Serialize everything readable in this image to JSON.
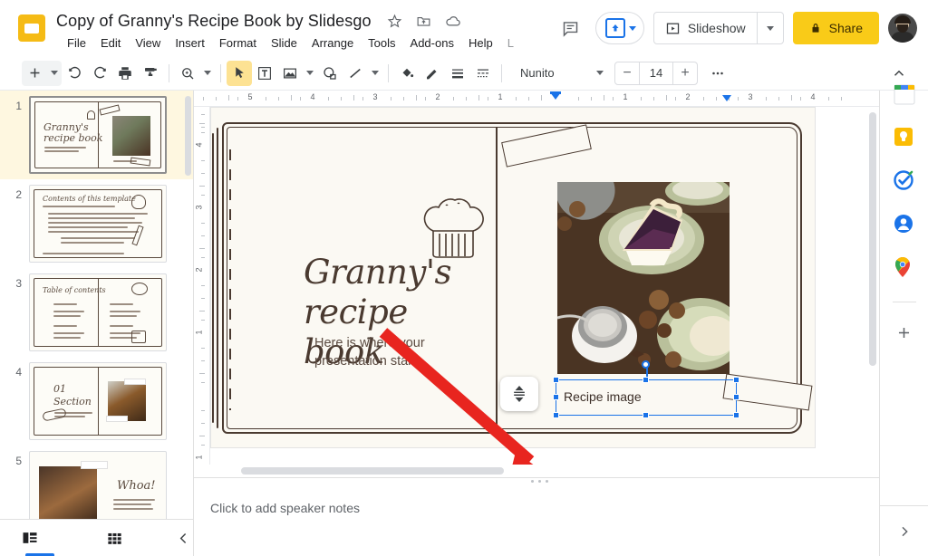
{
  "app": {
    "name": "Google Slides",
    "doc_title": "Copy of Granny's Recipe Book by Slidesgo",
    "logo_icon": "slides-logo-icon"
  },
  "title_actions": [
    {
      "name": "star-icon",
      "label": "Star"
    },
    {
      "name": "move-to-folder-icon",
      "label": "Move"
    },
    {
      "name": "cloud-saved-icon",
      "label": "Saved to Drive"
    }
  ],
  "menubar": {
    "items": [
      {
        "label": "File"
      },
      {
        "label": "Edit"
      },
      {
        "label": "View"
      },
      {
        "label": "Insert"
      },
      {
        "label": "Format"
      },
      {
        "label": "Slide"
      },
      {
        "label": "Arrange"
      },
      {
        "label": "Tools"
      },
      {
        "label": "Add-ons"
      },
      {
        "label": "Help"
      },
      {
        "label": "L"
      }
    ]
  },
  "top_right": {
    "comment_icon": "comment-icon",
    "present_icon": "present-to-meet-icon",
    "slideshow_label": "Slideshow",
    "slideshow_icon": "play-box-icon",
    "share_label": "Share",
    "share_icon": "lock-icon",
    "share_color": "#f9cb18",
    "avatar_name": "account-avatar"
  },
  "toolbar": {
    "items": [
      {
        "name": "new-slide-button",
        "icon": "plus-icon"
      },
      {
        "name": "new-slide-dropdown",
        "icon": "caret-down-icon"
      },
      {
        "name": "undo-button",
        "icon": "undo-icon"
      },
      {
        "name": "redo-button",
        "icon": "redo-icon"
      },
      {
        "name": "print-button",
        "icon": "printer-icon"
      },
      {
        "name": "paint-format-button",
        "icon": "paint-roller-icon"
      },
      {
        "name": "zoom-button",
        "icon": "magnifier-icon"
      },
      {
        "name": "zoom-dropdown",
        "icon": "caret-down-icon"
      },
      {
        "name": "select-tool-button",
        "icon": "cursor-arrow-icon"
      },
      {
        "name": "text-box-button",
        "icon": "textbox-icon"
      },
      {
        "name": "insert-image-button",
        "icon": "image-icon"
      },
      {
        "name": "insert-image-dropdown",
        "icon": "caret-down-icon"
      },
      {
        "name": "shape-button",
        "icon": "shape-icon"
      },
      {
        "name": "line-button",
        "icon": "line-icon"
      },
      {
        "name": "line-dropdown",
        "icon": "caret-down-icon"
      },
      {
        "name": "fill-color-button",
        "icon": "paint-bucket-icon"
      },
      {
        "name": "border-color-button",
        "icon": "pencil-icon"
      },
      {
        "name": "border-weight-button",
        "icon": "line-weight-icon"
      },
      {
        "name": "border-dash-button",
        "icon": "line-dash-icon"
      }
    ],
    "font_name": "Nunito",
    "font_size": "14",
    "decrease_label": "−",
    "increase_label": "+",
    "more_icon": "more-horizontal-icon",
    "collapse_icon": "chevron-up-icon"
  },
  "filmstrip": {
    "slides": [
      {
        "number": "1",
        "selected": true,
        "title": "Granny's recipe book",
        "kind": "title"
      },
      {
        "number": "2",
        "selected": false,
        "title": "Contents of this template",
        "kind": "contents"
      },
      {
        "number": "3",
        "selected": false,
        "title": "Table of contents",
        "kind": "toc"
      },
      {
        "number": "4",
        "selected": false,
        "title": "01 Section",
        "kind": "section"
      },
      {
        "number": "5",
        "selected": false,
        "title": "Whoa!",
        "kind": "whoa"
      }
    ],
    "bottom": {
      "filmstrip_view_icon": "filmstrip-view-icon",
      "grid_view_icon": "grid-view-icon",
      "collapse_icon": "chevron-left-icon"
    }
  },
  "rulers": {
    "horizontal_labels": [
      "5",
      "4",
      "3",
      "2",
      "1",
      "1",
      "2",
      "3",
      "4"
    ],
    "vertical_labels": [
      "4",
      "3",
      "2",
      "1",
      "1"
    ],
    "unit": "inches"
  },
  "slide": {
    "title": "Granny's\nrecipe book",
    "title_line1": "Granny's",
    "title_line2": "recipe book",
    "subtitle": "Here is where your presentation starts",
    "chef_hat_icon": "chef-hat-illustration",
    "photo_caption": "Recipe image",
    "photo_alt": "blueberry pie slice on green patterned plate",
    "selection_color": "#1a73e8",
    "annotation_arrow_color": "#e8251f",
    "paper_color": "#fbf9f3",
    "ink_color": "#4a3a30"
  },
  "notes": {
    "placeholder": "Click to add speaker notes",
    "explore_icon": "explore-icon"
  },
  "rail": {
    "items": [
      {
        "name": "google-calendar-icon",
        "label": "Calendar"
      },
      {
        "name": "google-keep-icon",
        "label": "Keep"
      },
      {
        "name": "google-tasks-icon",
        "label": "Tasks"
      },
      {
        "name": "google-contacts-icon",
        "label": "Contacts"
      },
      {
        "name": "google-maps-icon",
        "label": "Maps"
      }
    ],
    "add_on_label": "+",
    "collapse_icon": "chevron-right-icon"
  },
  "scrollbars": {
    "horizontal": "canvas-hscroll",
    "vertical": "canvas-vscroll",
    "filmstrip": "filmstrip-vscroll"
  }
}
